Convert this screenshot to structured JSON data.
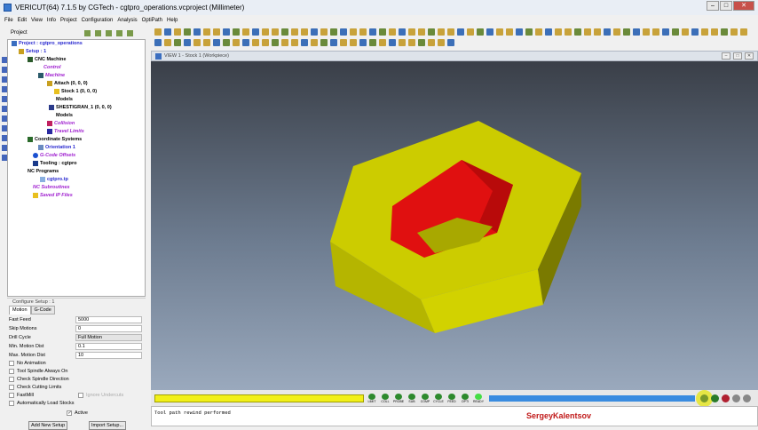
{
  "window": {
    "title": "VERICUT(64)  7.1.5 by CGTech - cgtpro_operations.vcproject (Millimeter)"
  },
  "menu": [
    "File",
    "Edit",
    "View",
    "Info",
    "Project",
    "Configuration",
    "Analysis",
    "OptiPath",
    "Help"
  ],
  "project_panel": {
    "title": "Project"
  },
  "tree": [
    {
      "label": "Project : cgtpro_operations",
      "style": "blue"
    },
    {
      "label": "Setup : 1",
      "style": "blue"
    },
    {
      "label": "CNC Machine",
      "style": "black"
    },
    {
      "label": "Control",
      "style": "purple"
    },
    {
      "label": "Machine",
      "style": "purple"
    },
    {
      "label": "Attach (0, 0, 0)",
      "style": "black"
    },
    {
      "label": "Stock 1 (0, 0, 0)",
      "style": "black"
    },
    {
      "label": "Models",
      "style": "black"
    },
    {
      "label": "SHESTIGRAN_1 (0, 0, 0)",
      "style": "black"
    },
    {
      "label": "Models",
      "style": "black"
    },
    {
      "label": "Collision",
      "style": "purple"
    },
    {
      "label": "Travel Limits",
      "style": "purple"
    },
    {
      "label": "Coordinate Systems",
      "style": "black"
    },
    {
      "label": "Orientation 1",
      "style": "blue"
    },
    {
      "label": "G-Code Offsets",
      "style": "purple"
    },
    {
      "label": "Tooling : cgtpro",
      "style": "black"
    },
    {
      "label": "NC Programs",
      "style": "black"
    },
    {
      "label": "cgtpro.tp",
      "style": "blue"
    },
    {
      "label": "NC Subroutines",
      "style": "purple"
    },
    {
      "label": "Saved IP Files",
      "style": "purple"
    }
  ],
  "configure": {
    "title": "Configure Setup : 1",
    "tabs": [
      "Motion",
      "G-Code"
    ],
    "fields": [
      {
        "label": "Fast Feed",
        "value": "5000"
      },
      {
        "label": "Skip Motions",
        "value": "0"
      },
      {
        "label": "Drill Cycle",
        "value": "Full Motion"
      },
      {
        "label": "Min. Motion Dist",
        "value": "0.1"
      },
      {
        "label": "Max. Motion Dist",
        "value": "10"
      }
    ],
    "checks": [
      "No Animation",
      "Tool Spindle Always On",
      "Check Spindle Direction",
      "Check Cutting Limits",
      "FastMill",
      "Automatically Load Stocks"
    ],
    "ignore_undercuts": "Ignore Undercuts",
    "active": "Active",
    "add_button": "Add New Setup",
    "import_button": "Import Setup..."
  },
  "view": {
    "title": "VIEW 1 - Stock 1 (Workpiece)"
  },
  "leds": [
    "LIMIT",
    "COLL",
    "PROBE",
    "SUB",
    "COMP",
    "CYCLE",
    "FEED",
    "OPTI",
    "READY"
  ],
  "log": "Tool path rewind performed",
  "watermark": "SergeyKalentsov",
  "colors": {
    "nut": "#cccc00",
    "hole": "#ee1111"
  }
}
